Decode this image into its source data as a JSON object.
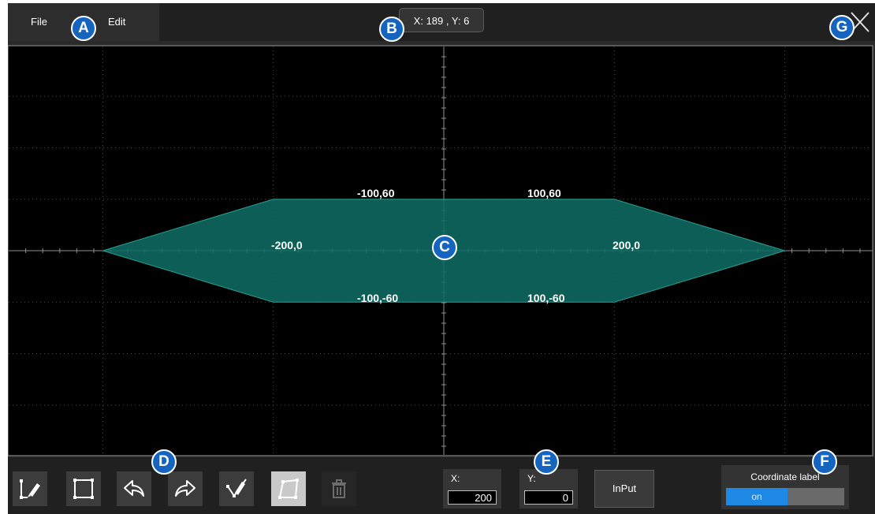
{
  "menu": {
    "items": [
      {
        "label": "File"
      },
      {
        "label": "Edit"
      }
    ]
  },
  "cursor_readout": {
    "x_prefix": "X: ",
    "x": "189",
    "separator": " , ",
    "y_prefix": "Y: ",
    "y": "6"
  },
  "close_icon": "close-icon",
  "shape": {
    "fill": "#0f6b63",
    "stroke": "#2a9d90",
    "vertices": [
      {
        "x": -200,
        "y": 0,
        "label": "-200,0"
      },
      {
        "x": -100,
        "y": 60,
        "label": "-100,60"
      },
      {
        "x": 100,
        "y": 60,
        "label": "100,60"
      },
      {
        "x": 200,
        "y": 0,
        "label": "200,0"
      },
      {
        "x": 100,
        "y": -60,
        "label": "100,-60"
      },
      {
        "x": -100,
        "y": -60,
        "label": "-100,-60"
      }
    ]
  },
  "plot": {
    "x_range": [
      -500,
      500
    ],
    "y_range": [
      -240,
      240
    ],
    "x_divisions": 10,
    "y_divisions": 8,
    "grid": true
  },
  "toolbar": {
    "tools": [
      {
        "name": "pen-polyline-tool",
        "icon": "pen-polyline-icon",
        "state": "normal"
      },
      {
        "name": "rectangle-tool",
        "icon": "rectangle-icon",
        "state": "normal"
      },
      {
        "name": "undo-button",
        "icon": "undo-icon",
        "state": "normal"
      },
      {
        "name": "redo-button",
        "icon": "redo-icon",
        "state": "normal"
      },
      {
        "name": "pen-edit-tool",
        "icon": "pen-node-icon",
        "state": "normal"
      },
      {
        "name": "polygon-tool",
        "icon": "polygon-icon",
        "state": "selected"
      },
      {
        "name": "delete-button",
        "icon": "trash-icon",
        "state": "disabled"
      }
    ],
    "x_label": "X:",
    "x_value": "200",
    "y_label": "Y:",
    "y_value": "0",
    "input_label": "InPut",
    "coord_label_title": "Coordinate label",
    "coord_label_state": "on"
  },
  "callouts": [
    "A",
    "B",
    "C",
    "D",
    "E",
    "F",
    "G"
  ],
  "colors": {
    "accent": "#1e88e5",
    "badge": "#1565c0",
    "plot_bg": "#2a2a2a",
    "toolbar_bg": "#202020"
  }
}
